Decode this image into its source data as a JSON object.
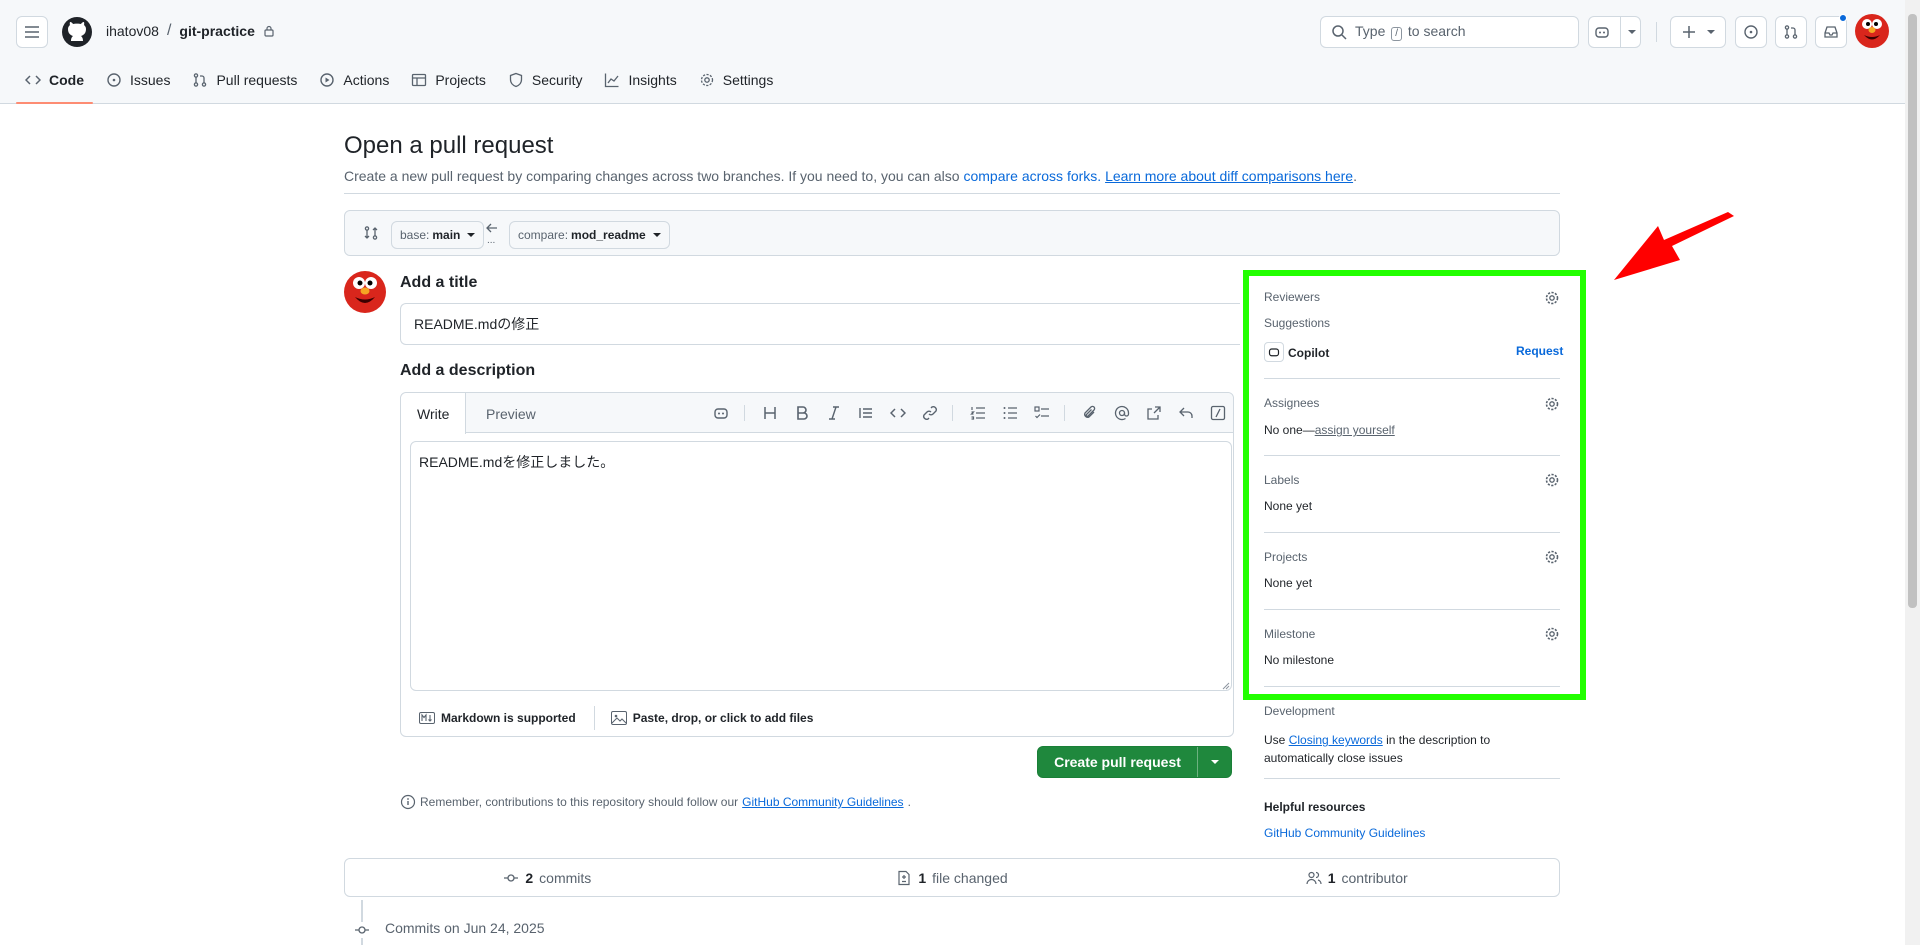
{
  "header": {
    "owner": "ihatov08",
    "separator": "/",
    "repo": "git-practice",
    "search_prefix": "Type",
    "search_key": "/",
    "search_suffix": "to search"
  },
  "nav_tabs": [
    {
      "label": "Code"
    },
    {
      "label": "Issues"
    },
    {
      "label": "Pull requests"
    },
    {
      "label": "Actions"
    },
    {
      "label": "Projects"
    },
    {
      "label": "Security"
    },
    {
      "label": "Insights"
    },
    {
      "label": "Settings"
    }
  ],
  "page": {
    "title": "Open a pull request",
    "subtitle_text": "Create a new pull request by comparing changes across two branches. If you need to, you can also",
    "compare_forks_link": "compare across forks.",
    "learn_more_link": "Learn more about diff comparisons here",
    "subtitle_end": "."
  },
  "range": {
    "base_label": "base:",
    "base_value": "main",
    "compare_label": "compare:",
    "compare_value": "mod_readme",
    "dots": "..."
  },
  "form": {
    "title_heading": "Add a title",
    "title_value": "README.mdの修正",
    "description_heading": "Add a description",
    "write_tab": "Write",
    "preview_tab": "Preview",
    "description_value": "README.mdを修正しました。",
    "markdown_note": "Markdown is supported",
    "attach_note": "Paste, drop, or click to add files",
    "create_button": "Create pull request",
    "remember_text": "Remember, contributions to this repository should follow our",
    "guidelines_link": "GitHub Community Guidelines",
    "remember_end": "."
  },
  "sidebar": {
    "reviewers_heading": "Reviewers",
    "suggestions_label": "Suggestions",
    "copilot_label": "Copilot",
    "request_link": "Request",
    "assignees_heading": "Assignees",
    "assignees_none": "No one—",
    "assign_yourself_link": "assign yourself",
    "labels_heading": "Labels",
    "labels_value": "None yet",
    "projects_heading": "Projects",
    "projects_value": "None yet",
    "milestone_heading": "Milestone",
    "milestone_value": "No milestone",
    "development_heading": "Development",
    "dev_use": "Use",
    "dev_link": "Closing keywords",
    "dev_rest": "in the description to",
    "dev_line2": "automatically close issues",
    "helpful_heading": "Helpful resources",
    "helpful_link": "GitHub Community Guidelines"
  },
  "stats": {
    "commits_count": "2",
    "commits_label": "commits",
    "files_count": "1",
    "files_label": "file changed",
    "contributors_count": "1",
    "contributors_label": "contributor"
  },
  "commits_on": "Commits on Jun 24, 2025",
  "colors": {
    "highlight": "#22ff00",
    "arrow": "#ff0000",
    "create_button": "#1f883d",
    "link": "#0969da",
    "active_tab_underline": "#fd8c73"
  }
}
